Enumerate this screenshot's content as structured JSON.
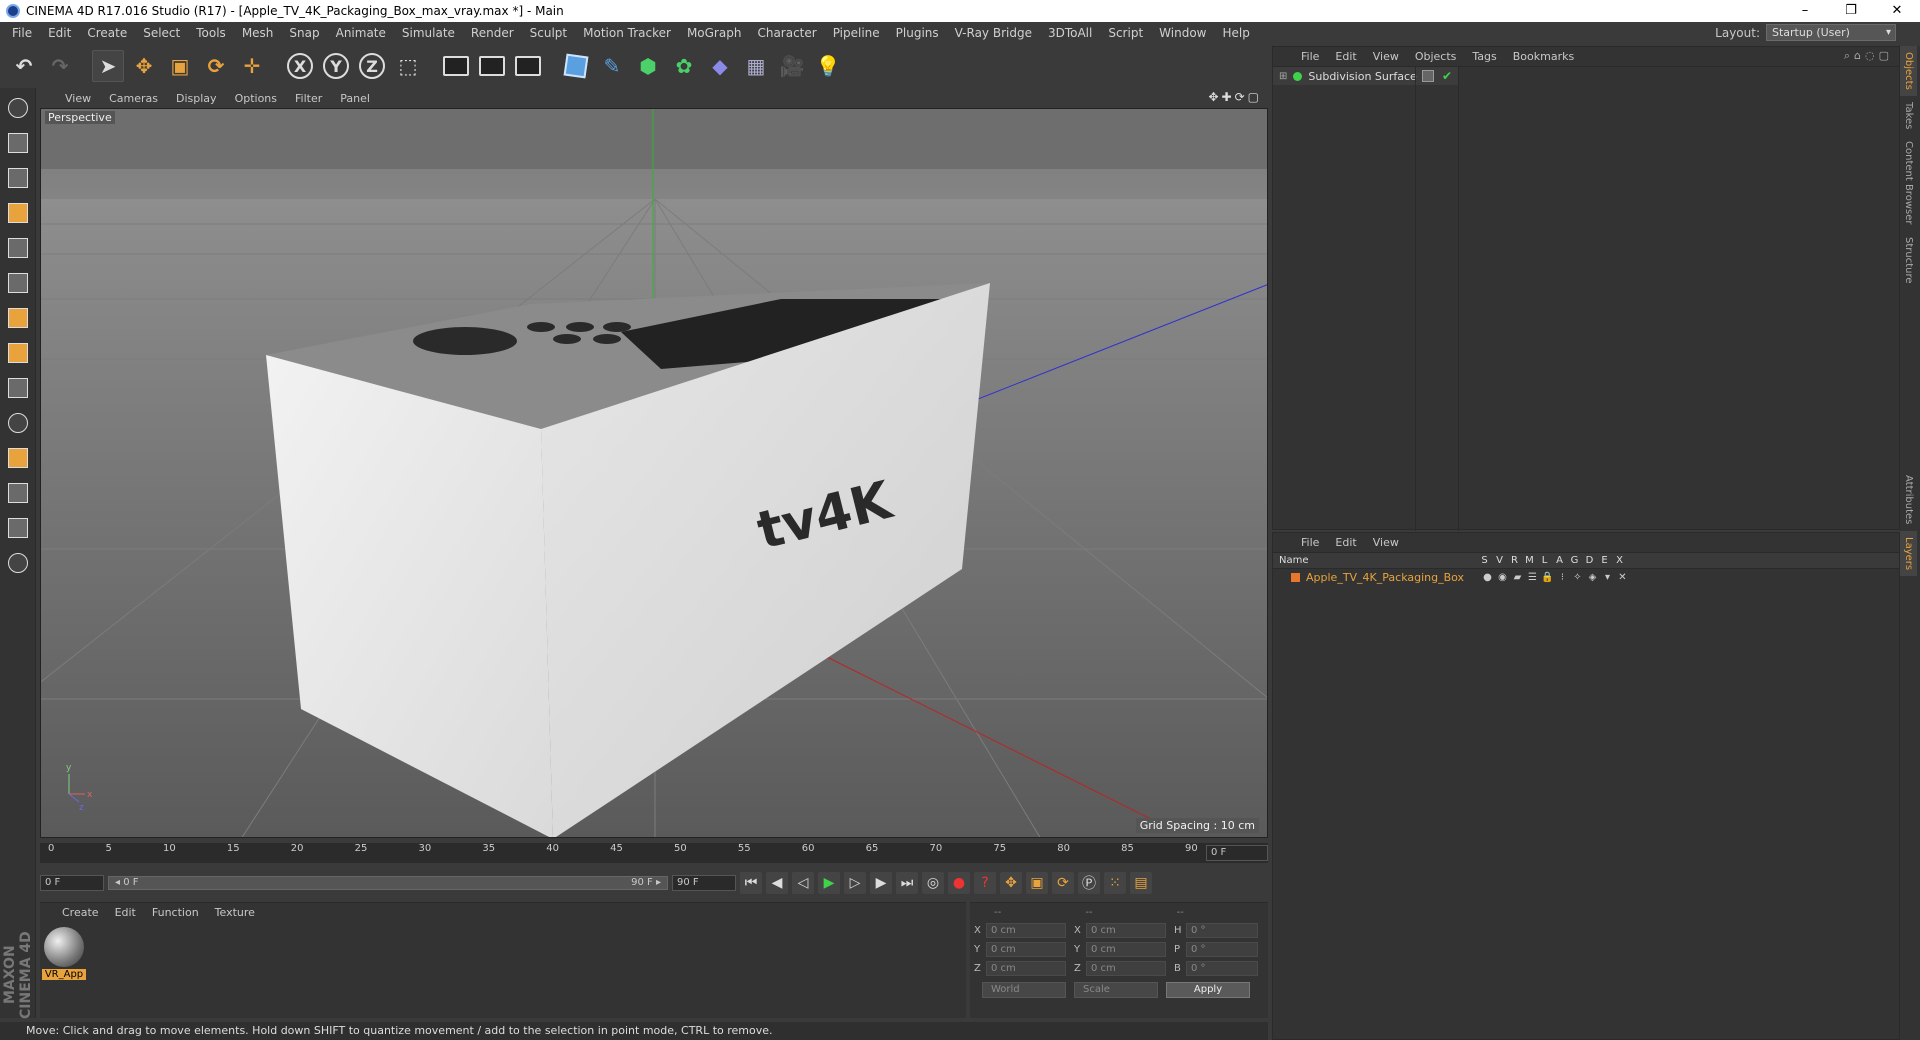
{
  "window": {
    "title": "CINEMA 4D R17.016 Studio (R17) - [Apple_TV_4K_Packaging_Box_max_vray.max *] - Main",
    "controls": [
      "–",
      "❐",
      "✕"
    ]
  },
  "menu": [
    "File",
    "Edit",
    "Create",
    "Select",
    "Tools",
    "Mesh",
    "Snap",
    "Animate",
    "Simulate",
    "Render",
    "Sculpt",
    "Motion Tracker",
    "MoGraph",
    "Character",
    "Pipeline",
    "Plugins",
    "V-Ray Bridge",
    "3DToAll",
    "Script",
    "Window",
    "Help"
  ],
  "layout": {
    "label": "Layout:",
    "value": "Startup (User)"
  },
  "toolbar": {
    "axis_x": "X",
    "axis_y": "Y",
    "axis_z": "Z"
  },
  "viewport": {
    "menu": [
      "View",
      "Cameras",
      "Display",
      "Options",
      "Filter",
      "Panel"
    ],
    "label": "Perspective",
    "grid_spacing": "Grid Spacing : 10 cm",
    "box_logo": "tv4K",
    "axis_y": "y",
    "axis_x": "x",
    "axis_z": "z"
  },
  "timeline": {
    "ticks": [
      "0",
      "5",
      "10",
      "15",
      "20",
      "25",
      "30",
      "35",
      "40",
      "45",
      "50",
      "55",
      "60",
      "65",
      "70",
      "75",
      "80",
      "85",
      "90"
    ],
    "current_frame": "0 F"
  },
  "playback": {
    "start": "0 F",
    "slider_start": "◂ 0 F",
    "slider_end": "90 F ▸",
    "end": "90 F"
  },
  "materials": {
    "menu": [
      "Create",
      "Edit",
      "Function",
      "Texture"
    ],
    "items": [
      {
        "name": "VR_App"
      }
    ]
  },
  "coords": {
    "headers": [
      "--",
      "--",
      "--"
    ],
    "rows": [
      {
        "a": "X",
        "v1": "0 cm",
        "b": "X",
        "v2": "0 cm",
        "c": "H",
        "v3": "0 °"
      },
      {
        "a": "Y",
        "v1": "0 cm",
        "b": "Y",
        "v2": "0 cm",
        "c": "P",
        "v3": "0 °"
      },
      {
        "a": "Z",
        "v1": "0 cm",
        "b": "Z",
        "v2": "0 cm",
        "c": "B",
        "v3": "0 °"
      }
    ],
    "space": "World",
    "mode": "Scale",
    "apply": "Apply"
  },
  "status": "Move: Click and drag to move elements. Hold down SHIFT to quantize movement / add to the selection in point mode, CTRL to remove.",
  "brand": "MAXON CINEMA 4D",
  "objects": {
    "menu": [
      "File",
      "Edit",
      "View",
      "Objects",
      "Tags",
      "Bookmarks"
    ],
    "items": [
      {
        "name": "Subdivision Surface"
      }
    ]
  },
  "layers": {
    "menu": [
      "File",
      "Edit",
      "View"
    ],
    "columns": [
      "Name",
      "S",
      "V",
      "R",
      "M",
      "L",
      "A",
      "G",
      "D",
      "E",
      "X"
    ],
    "items": [
      {
        "name": "Apple_TV_4K_Packaging_Box"
      }
    ]
  },
  "sidetabs": [
    "Objects",
    "Takes",
    "Content Browser",
    "Structure",
    "Attributes",
    "Layers"
  ]
}
